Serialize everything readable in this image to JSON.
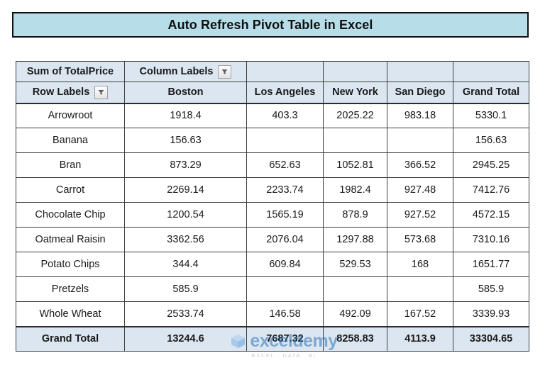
{
  "title": {
    "text": "Auto Refresh Pivot Table in Excel",
    "banner_bg": "#b7dde8",
    "border_color": "#111111"
  },
  "pivot": {
    "header_bg": "#dce6f1",
    "value_label": "Sum of TotalPrice",
    "column_labels_label": "Column Labels",
    "row_labels_label": "Row Labels",
    "filter_icon": "filter-dropdown-icon",
    "columns": [
      "Boston",
      "Los Angeles",
      "New York",
      "San Diego",
      "Grand Total"
    ],
    "rows": [
      {
        "label": "Arrowroot",
        "values": [
          "1918.4",
          "403.3",
          "2025.22",
          "983.18",
          "5330.1"
        ]
      },
      {
        "label": "Banana",
        "values": [
          "156.63",
          "",
          "",
          "",
          "156.63"
        ]
      },
      {
        "label": "Bran",
        "values": [
          "873.29",
          "652.63",
          "1052.81",
          "366.52",
          "2945.25"
        ]
      },
      {
        "label": "Carrot",
        "values": [
          "2269.14",
          "2233.74",
          "1982.4",
          "927.48",
          "7412.76"
        ]
      },
      {
        "label": "Chocolate Chip",
        "values": [
          "1200.54",
          "1565.19",
          "878.9",
          "927.52",
          "4572.15"
        ]
      },
      {
        "label": "Oatmeal Raisin",
        "values": [
          "3362.56",
          "2076.04",
          "1297.88",
          "573.68",
          "7310.16"
        ]
      },
      {
        "label": "Potato Chips",
        "values": [
          "344.4",
          "609.84",
          "529.53",
          "168",
          "1651.77"
        ]
      },
      {
        "label": "Pretzels",
        "values": [
          "585.9",
          "",
          "",
          "",
          "585.9"
        ]
      },
      {
        "label": "Whole Wheat",
        "values": [
          "2533.74",
          "146.58",
          "492.09",
          "167.52",
          "3339.93"
        ]
      }
    ],
    "total_row": {
      "label": "Grand Total",
      "values": [
        "13244.6",
        "7687.32",
        "8258.83",
        "4113.9",
        "33304.65"
      ]
    }
  },
  "watermark": {
    "word": "exceldemy",
    "tagline": "EXCEL · DATA · BI",
    "color": "#2e75b6"
  }
}
